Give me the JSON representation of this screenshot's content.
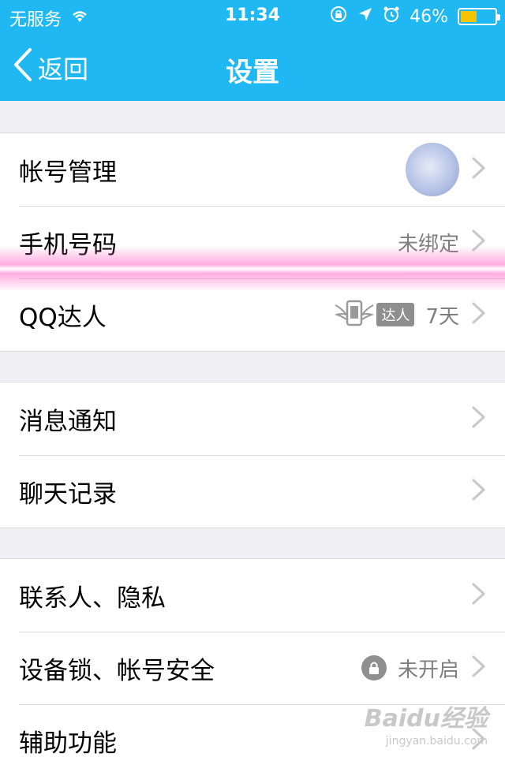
{
  "status_bar": {
    "carrier": "无服务",
    "time": "11:34",
    "battery_percent": "46%",
    "icons": [
      "wifi-icon",
      "orientation-lock-icon",
      "location-icon",
      "alarm-icon",
      "battery-icon"
    ]
  },
  "nav": {
    "back_label": "返回",
    "title": "设置"
  },
  "groups": [
    {
      "rows": [
        {
          "label": "帐号管理",
          "value": "",
          "accessory": "avatar"
        },
        {
          "label": "手机号码",
          "value": "未绑定"
        },
        {
          "label": "QQ达人",
          "badge": "达人",
          "value": "7天"
        }
      ]
    },
    {
      "rows": [
        {
          "label": "消息通知",
          "value": ""
        },
        {
          "label": "聊天记录",
          "value": ""
        }
      ]
    },
    {
      "rows": [
        {
          "label": "联系人、隐私",
          "value": ""
        },
        {
          "label": "设备锁、帐号安全",
          "value": "未开启",
          "accessory": "lock-icon"
        },
        {
          "label": "辅助功能",
          "value": ""
        }
      ]
    }
  ],
  "watermark": {
    "text": "Baidu经验",
    "sub": "jingyan.baidu.com"
  },
  "colors": {
    "header": "#1fb8f3",
    "background": "#efeff4",
    "battery_fill": "#f5c400"
  }
}
